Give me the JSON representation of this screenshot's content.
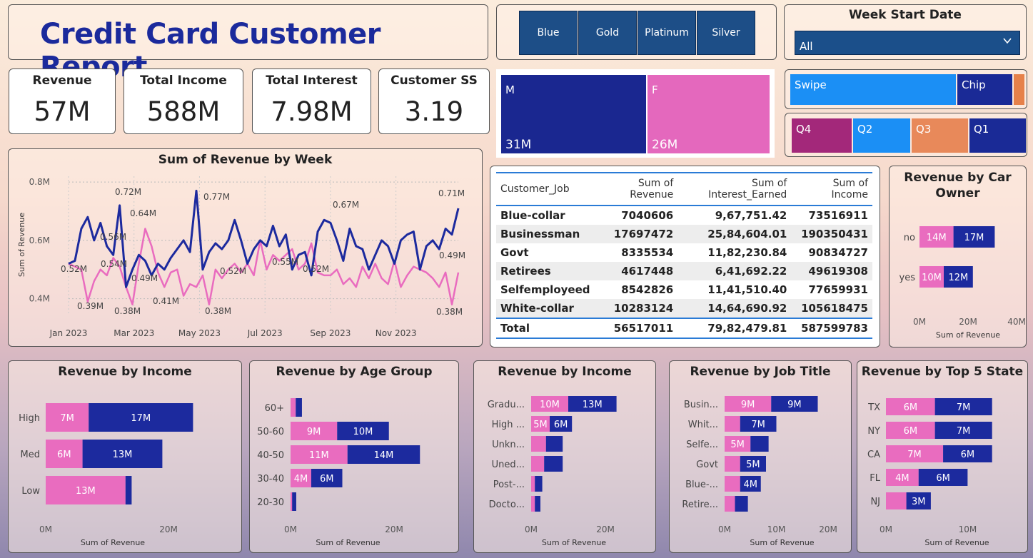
{
  "title": "Credit Card Customer Report",
  "kpis": [
    {
      "label": "Revenue",
      "value": "57M"
    },
    {
      "label": "Total Income",
      "value": "588M"
    },
    {
      "label": "Total Interest",
      "value": "7.98M"
    },
    {
      "label": "Customer SS",
      "value": "3.19"
    }
  ],
  "card_tiers": [
    "Blue",
    "Gold",
    "Platinum",
    "Silver"
  ],
  "week_filter": {
    "label": "Week Start Date",
    "value": "All"
  },
  "gender": [
    {
      "key": "M",
      "value": "31M",
      "color": "#1a2790"
    },
    {
      "key": "F",
      "value": "26M",
      "color": "#e468bd"
    }
  ],
  "payment": [
    {
      "label": "Swipe",
      "color": "#1b8ff5"
    },
    {
      "label": "Chip",
      "color": "#1a2a96"
    },
    {
      "label": "",
      "color": "#e6814a"
    }
  ],
  "quarters": [
    {
      "label": "Q4",
      "color": "#a3287a"
    },
    {
      "label": "Q2",
      "color": "#1b8ff5"
    },
    {
      "label": "Q3",
      "color": "#e8895a"
    },
    {
      "label": "Q1",
      "color": "#1a2a96"
    }
  ],
  "colors": {
    "pink": "#e96cbf",
    "navy": "#1c2a9e"
  },
  "chart_data": [
    {
      "type": "line",
      "title": "Sum of Revenue by Week",
      "ylabel": "Sum of Revenue",
      "ylim": [
        0.35,
        0.82
      ],
      "yticks": [
        "0.4M",
        "0.6M",
        "0.8M"
      ],
      "xticks": [
        "Jan 2023",
        "Mar 2023",
        "May 2023",
        "Jul 2023",
        "Sep 2023",
        "Nov 2023"
      ],
      "series": [
        {
          "values": [
            0.52,
            0.53,
            0.64,
            0.68,
            0.6,
            0.66,
            0.58,
            0.55,
            0.72,
            0.44,
            0.5,
            0.55,
            0.53,
            0.48,
            0.52,
            0.5,
            0.54,
            0.57,
            0.6,
            0.56,
            0.77,
            0.5,
            0.56,
            0.59,
            0.57,
            0.6,
            0.67,
            0.6,
            0.52,
            0.57,
            0.6,
            0.58,
            0.65,
            0.58,
            0.62,
            0.5,
            0.55,
            0.56,
            0.48,
            0.63,
            0.67,
            0.66,
            0.6,
            0.53,
            0.64,
            0.58,
            0.57,
            0.5,
            0.55,
            0.6,
            0.58,
            0.52,
            0.6,
            0.62,
            0.63,
            0.5,
            0.58,
            0.6,
            0.57,
            0.64,
            0.62,
            0.71
          ]
        },
        {
          "values": [
            0.52,
            0.51,
            0.5,
            0.39,
            0.46,
            0.5,
            0.48,
            0.54,
            0.51,
            0.44,
            0.38,
            0.52,
            0.64,
            0.58,
            0.49,
            0.44,
            0.49,
            0.5,
            0.41,
            0.45,
            0.44,
            0.48,
            0.38,
            0.5,
            0.47,
            0.5,
            0.52,
            0.49,
            0.52,
            0.48,
            0.6,
            0.5,
            0.55,
            0.53,
            0.55,
            0.57,
            0.5,
            0.52,
            0.59,
            0.49,
            0.48,
            0.48,
            0.5,
            0.45,
            0.47,
            0.44,
            0.51,
            0.47,
            0.52,
            0.47,
            0.45,
            0.53,
            0.44,
            0.48,
            0.51,
            0.5,
            0.49,
            0.47,
            0.44,
            0.49,
            0.38,
            0.49
          ]
        }
      ],
      "data_labels": [
        "0.72M",
        "0.64M",
        "0.56M",
        "0.54M",
        "0.52M",
        "0.49M",
        "0.39M",
        "0.38M",
        "0.41M",
        "0.77M",
        "0.52M",
        "0.38M",
        "0.55M",
        "0.52M",
        "0.67M",
        "0.71M",
        "0.49M",
        "0.38M"
      ]
    },
    {
      "type": "bar",
      "title": "Revenue by Car Owner",
      "xlabel": "Sum of Revenue",
      "xticks": [
        "0M",
        "20M",
        "40M"
      ],
      "xmax": 40,
      "categories": [
        "no",
        "yes"
      ],
      "series": [
        {
          "values": [
            14,
            10
          ],
          "labels": [
            "14M",
            "10M"
          ]
        },
        {
          "values": [
            17,
            12
          ],
          "labels": [
            "17M",
            "12M"
          ]
        }
      ]
    },
    {
      "type": "bar",
      "title": "Revenue by Income",
      "xlabel": "Sum of Revenue",
      "xticks": [
        "0M",
        "20M"
      ],
      "xmax": 20,
      "categories": [
        "High",
        "Med",
        "Low"
      ],
      "series": [
        {
          "values": [
            7,
            6,
            13
          ],
          "labels": [
            "7M",
            "6M",
            "13M"
          ]
        },
        {
          "values": [
            17,
            13,
            1
          ],
          "labels": [
            "17M",
            "13M",
            ""
          ]
        }
      ]
    },
    {
      "type": "bar",
      "title": "Revenue by Age Group",
      "xlabel": "Sum of Revenue",
      "xticks": [
        "0M",
        "20M"
      ],
      "xmax": 20,
      "categories": [
        "60+",
        "50-60",
        "40-50",
        "30-40",
        "20-30"
      ],
      "series": [
        {
          "values": [
            1,
            9,
            11,
            4,
            0.3
          ],
          "labels": [
            "",
            "9M",
            "11M",
            "4M",
            ""
          ]
        },
        {
          "values": [
            1.2,
            10,
            14,
            6,
            0.8
          ],
          "labels": [
            "",
            "10M",
            "14M",
            "6M",
            ""
          ]
        }
      ]
    },
    {
      "type": "bar",
      "title": "Revenue by Income",
      "xlabel": "Sum of Revenue",
      "xticks": [
        "0M",
        "20M"
      ],
      "xmax": 20,
      "categories": [
        "Gradu...",
        "High ...",
        "Unkn...",
        "Uned...",
        "Post-...",
        "Docto..."
      ],
      "series": [
        {
          "values": [
            10,
            5,
            4,
            3.5,
            1,
            1
          ],
          "labels": [
            "10M",
            "5M",
            "",
            "",
            "",
            ""
          ]
        },
        {
          "values": [
            13,
            6,
            4.5,
            5,
            2,
            1.5
          ],
          "labels": [
            "13M",
            "6M",
            "",
            "",
            "",
            ""
          ]
        }
      ]
    },
    {
      "type": "bar",
      "title": "Revenue by Job Title",
      "xlabel": "Sum of Revenue",
      "xticks": [
        "0M",
        "10M",
        "20M"
      ],
      "xmax": 20,
      "categories": [
        "Busin...",
        "Whit...",
        "Selfe...",
        "Govt",
        "Blue-...",
        "Retire..."
      ],
      "series": [
        {
          "values": [
            9,
            3,
            5,
            3,
            3,
            2
          ],
          "labels": [
            "9M",
            "",
            "5M",
            "",
            "",
            ""
          ]
        },
        {
          "values": [
            9,
            7,
            3.5,
            5,
            4,
            2.5
          ],
          "labels": [
            "9M",
            "7M",
            "",
            "5M",
            "4M",
            ""
          ]
        }
      ]
    },
    {
      "type": "bar",
      "title": "Revenue by Top 5 State",
      "xlabel": "Sum of Revenue",
      "xticks": [
        "0M",
        "10M"
      ],
      "xmax": 16,
      "categories": [
        "TX",
        "NY",
        "CA",
        "FL",
        "NJ"
      ],
      "series": [
        {
          "values": [
            6,
            6,
            7,
            4,
            2.5
          ],
          "labels": [
            "6M",
            "6M",
            "7M",
            "4M",
            ""
          ]
        },
        {
          "values": [
            7,
            7,
            6,
            6,
            3
          ],
          "labels": [
            "7M",
            "7M",
            "6M",
            "6M",
            "3M"
          ]
        }
      ]
    }
  ],
  "job_table": {
    "columns": [
      "Customer_Job",
      "Sum of Revenue",
      "Sum of Interest_Earned",
      "Sum of Income"
    ],
    "rows": [
      [
        "Blue-collar",
        "7040606",
        "9,67,751.42",
        "73516911"
      ],
      [
        "Businessman",
        "17697472",
        "25,84,604.01",
        "190350431"
      ],
      [
        "Govt",
        "8335534",
        "11,82,230.84",
        "90834727"
      ],
      [
        "Retirees",
        "4617448",
        "6,41,692.22",
        "49619308"
      ],
      [
        "Selfemployeed",
        "8542826",
        "11,41,510.40",
        "77659931"
      ],
      [
        "White-collar",
        "10283124",
        "14,64,690.92",
        "105618475"
      ]
    ],
    "total": [
      "Total",
      "56517011",
      "79,82,479.81",
      "587599783"
    ]
  }
}
